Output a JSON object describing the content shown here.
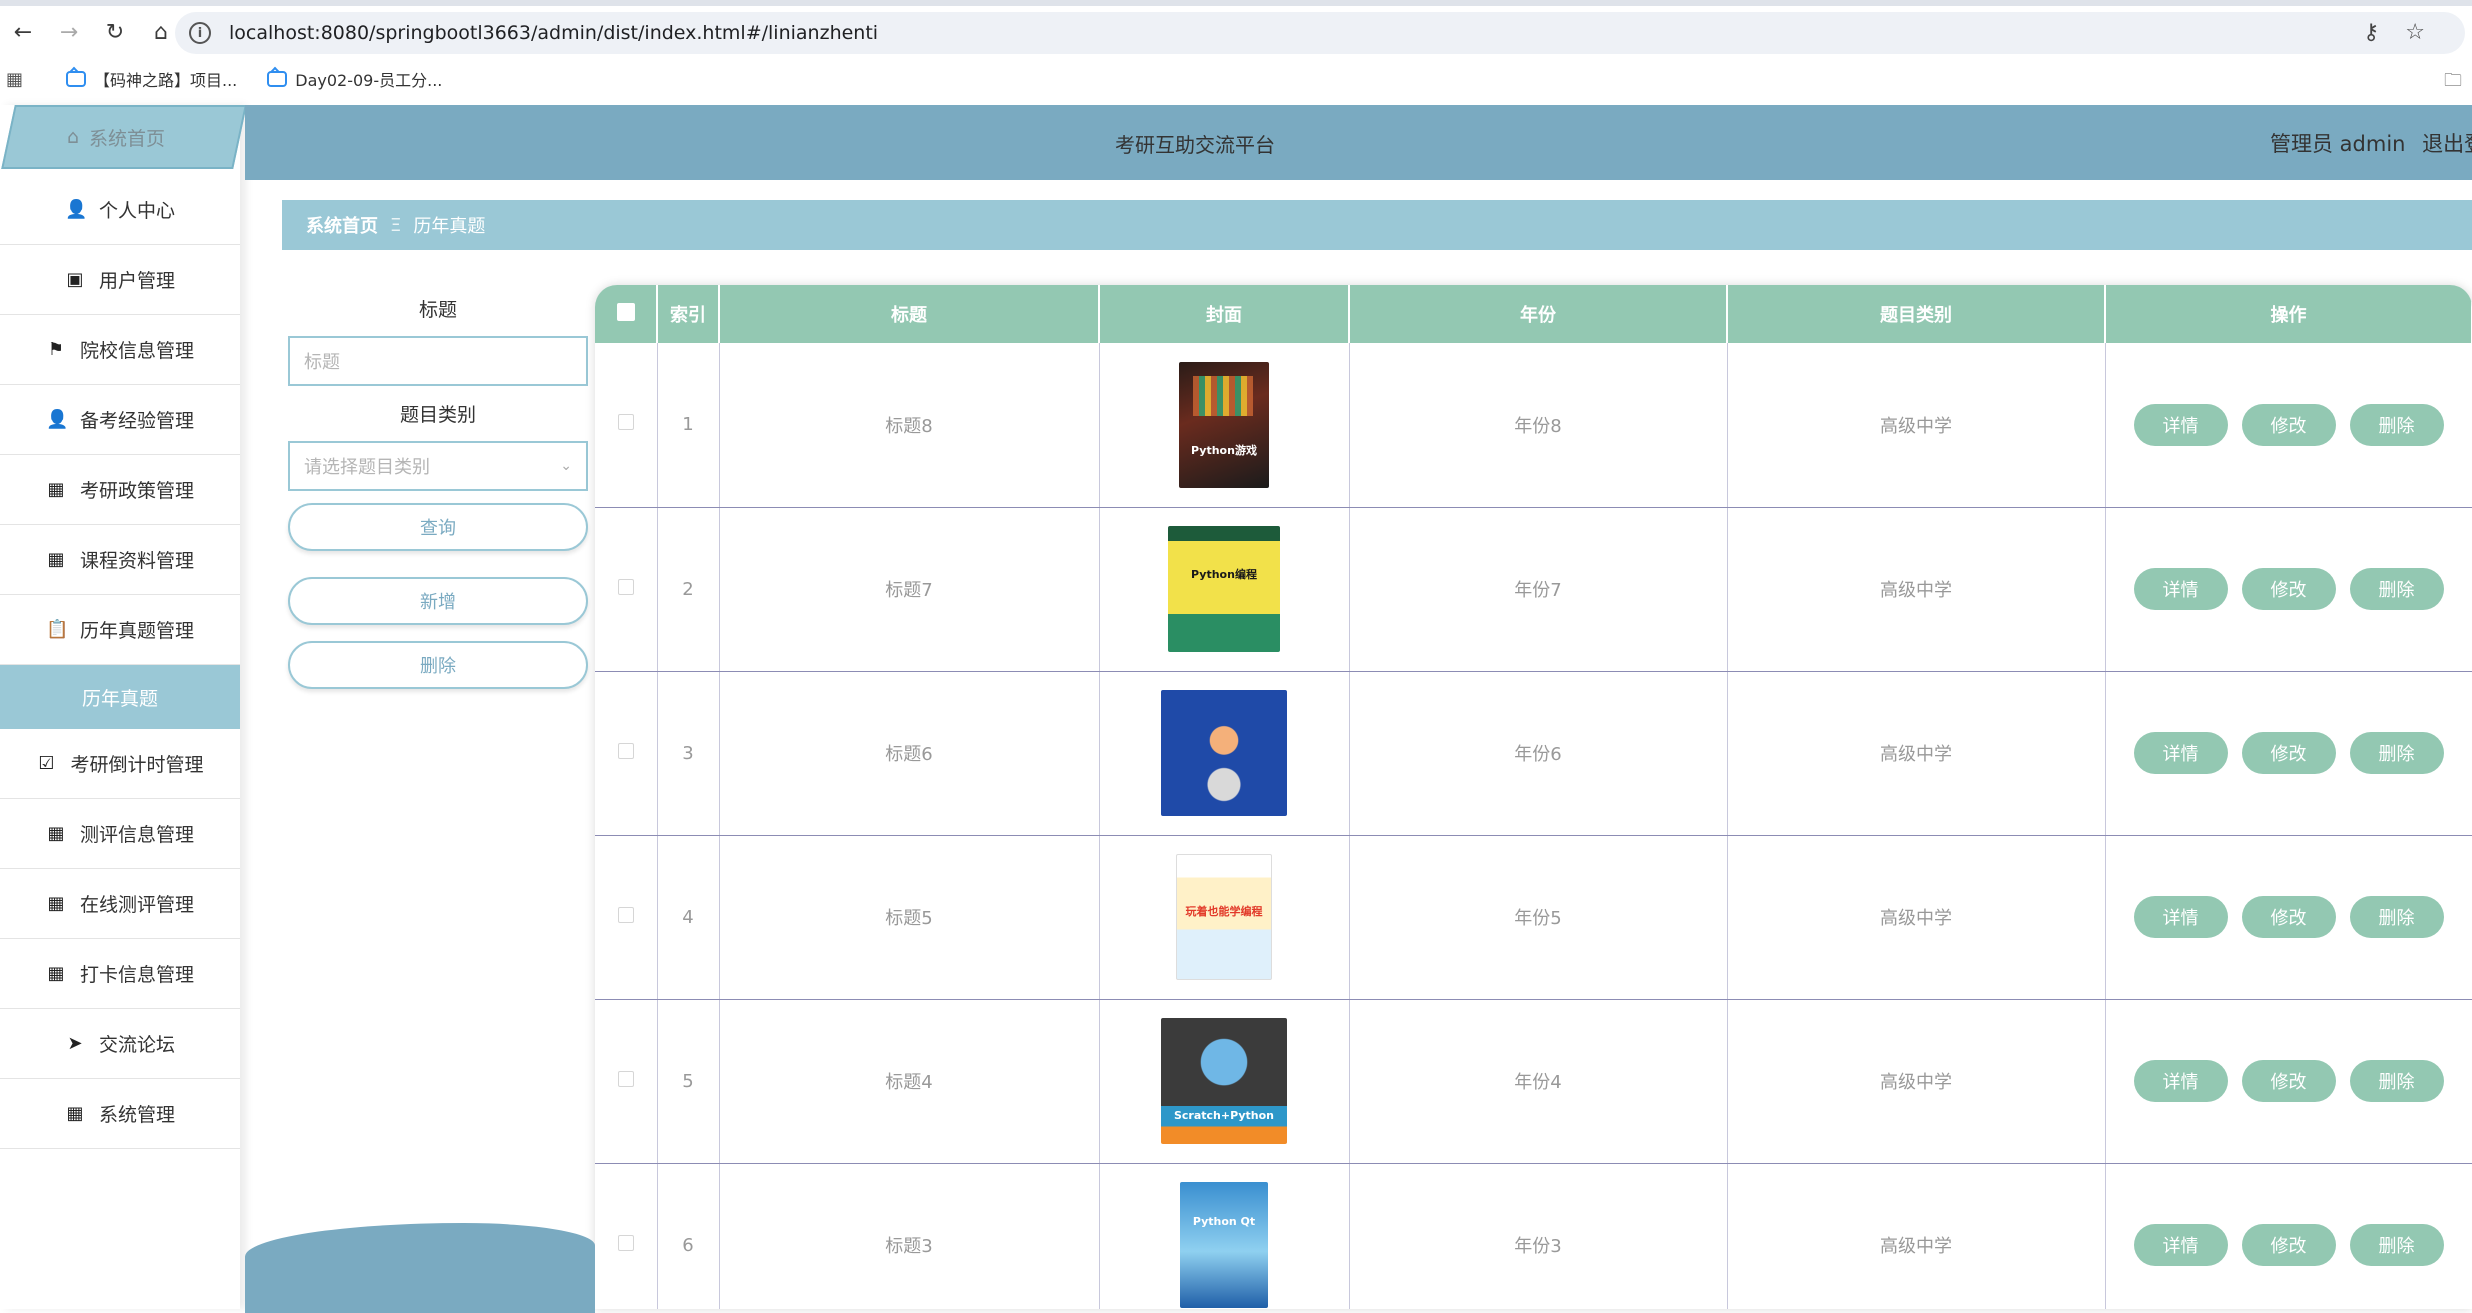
{
  "browser": {
    "url": "localhost:8080/springbootl3663/admin/dist/index.html#/linianzhenti",
    "bookmarks": [
      "【码神之路】项目...",
      "Day02-09-员工分..."
    ]
  },
  "header": {
    "title": "考研互助交流平台",
    "user": "管理员 admin",
    "logout": "退出登"
  },
  "sidebar": {
    "home": "系统首页",
    "items": [
      {
        "label": "个人中心",
        "icon": "user-icon"
      },
      {
        "label": "用户管理",
        "icon": "monitor-icon"
      },
      {
        "label": "院校信息管理",
        "icon": "flag-icon"
      },
      {
        "label": "备考经验管理",
        "icon": "person-icon"
      },
      {
        "label": "考研政策管理",
        "icon": "grid-icon"
      },
      {
        "label": "课程资料管理",
        "icon": "grid-icon"
      },
      {
        "label": "历年真题管理",
        "icon": "clipboard-icon"
      }
    ],
    "active_sub": "历年真题",
    "items2": [
      {
        "label": "考研倒计时管理",
        "icon": "clipboard-check-icon"
      },
      {
        "label": "测评信息管理",
        "icon": "grid9-icon"
      },
      {
        "label": "在线测评管理",
        "icon": "grid-icon"
      },
      {
        "label": "打卡信息管理",
        "icon": "grid-icon"
      },
      {
        "label": "交流论坛",
        "icon": "paper-plane-icon"
      },
      {
        "label": "系统管理",
        "icon": "grid-icon"
      }
    ]
  },
  "breadcrumb": {
    "home": "系统首页",
    "separator": "Ξ",
    "current": "历年真题"
  },
  "search": {
    "title_label": "标题",
    "title_placeholder": "标题",
    "category_label": "题目类别",
    "category_placeholder": "请选择题目类别",
    "query_button": "查询",
    "add_button": "新增",
    "delete_button": "删除"
  },
  "table": {
    "headers": [
      "索引",
      "标题",
      "封面",
      "年份",
      "题目类别",
      "操作"
    ],
    "actions": [
      "详情",
      "修改",
      "删除"
    ],
    "rows": [
      {
        "index": "1",
        "title": "标题8",
        "year": "年份8",
        "category": "高级中学",
        "cover_text": "Python游戏"
      },
      {
        "index": "2",
        "title": "标题7",
        "year": "年份7",
        "category": "高级中学",
        "cover_text": "Python编程"
      },
      {
        "index": "3",
        "title": "标题6",
        "year": "年份6",
        "category": "高级中学",
        "cover_text": ""
      },
      {
        "index": "4",
        "title": "标题5",
        "year": "年份5",
        "category": "高级中学",
        "cover_text": "玩着也能学编程"
      },
      {
        "index": "5",
        "title": "标题4",
        "year": "年份4",
        "category": "高级中学",
        "cover_text": "Scratch+Python"
      },
      {
        "index": "6",
        "title": "标题3",
        "year": "年份3",
        "category": "高级中学",
        "cover_text": "Python Qt"
      }
    ]
  },
  "colors": {
    "header": "#7aaac1",
    "accent": "#9ac8d6",
    "table_head": "#93c8b2"
  }
}
